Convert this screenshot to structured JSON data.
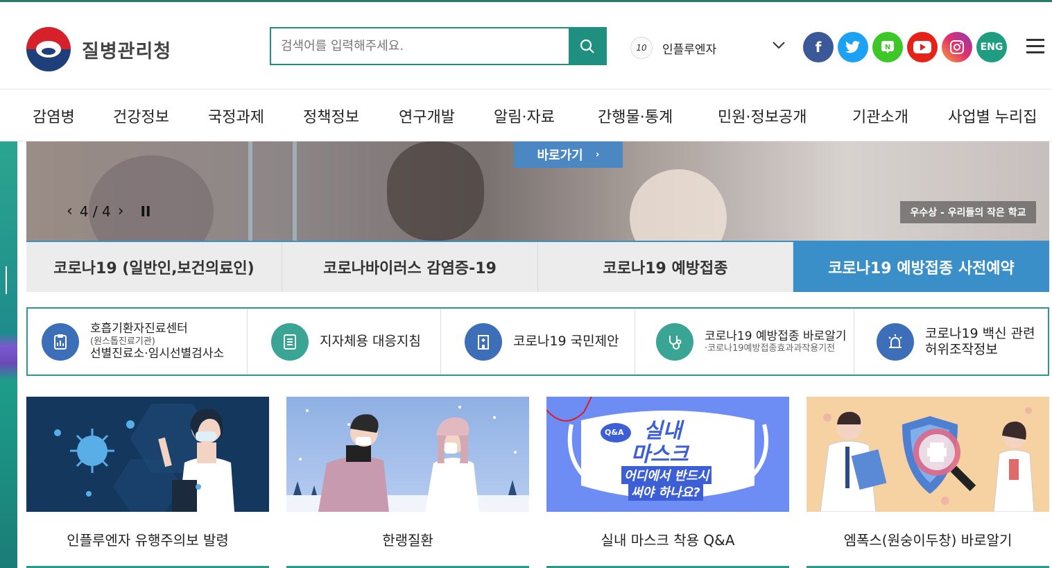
{
  "header": {
    "logo_text": "질병관리청",
    "search": {
      "placeholder": "검색어를 입력해주세요."
    },
    "ranking": {
      "number": "10",
      "keyword": "인플루엔자"
    },
    "sns": [
      "facebook-icon",
      "twitter-icon",
      "naver-blog-icon",
      "youtube-icon",
      "instagram-icon"
    ],
    "lang_label": "ENG"
  },
  "gnb": [
    "감염병",
    "건강정보",
    "국정과제",
    "정책정보",
    "연구개발",
    "알림·자료",
    "간행물·통계",
    "민원·정보공개",
    "기관소개",
    "사업별 누리집"
  ],
  "banner": {
    "goto_label": "바로가기",
    "counter": "4 / 4",
    "caption": "우수상 - 우리들의 작은 학교"
  },
  "tabs": [
    "코로나19 (일반인,보건의료인)",
    "코로나바이러스 감염증-19",
    "코로나19 예방접종",
    "코로나19 예방접종 사전예약"
  ],
  "quick_links": [
    {
      "line1": "호흡기환자진료센터",
      "sub": "(원스톱진료기관)",
      "line2": "선별진료소·임시선별검사소"
    },
    {
      "line1": "지자체용 대응지침"
    },
    {
      "line1": "코로나19 국민제안"
    },
    {
      "line1": "코로나19 예방접종 바로알기",
      "sub": "·코로나19예방접종효과과작용기전"
    },
    {
      "line1": "코로나19 백신 관련",
      "line2": "허위조작정보"
    }
  ],
  "cards": [
    {
      "title": "인플루엔자 유행주의보 발령"
    },
    {
      "title": "한랭질환"
    },
    {
      "title": "실내 마스크 착용 Q&A",
      "badge": "Q&A",
      "art_line1": "실내",
      "art_line2": "마스크",
      "art_line3": "어디에서 반드시",
      "art_line4": "써야 하나요?"
    },
    {
      "title": "엠폭스(원숭이두창) 바로알기"
    }
  ],
  "colors": {
    "brand": "#1f8f80",
    "tab_active": "#3a8fc9"
  }
}
